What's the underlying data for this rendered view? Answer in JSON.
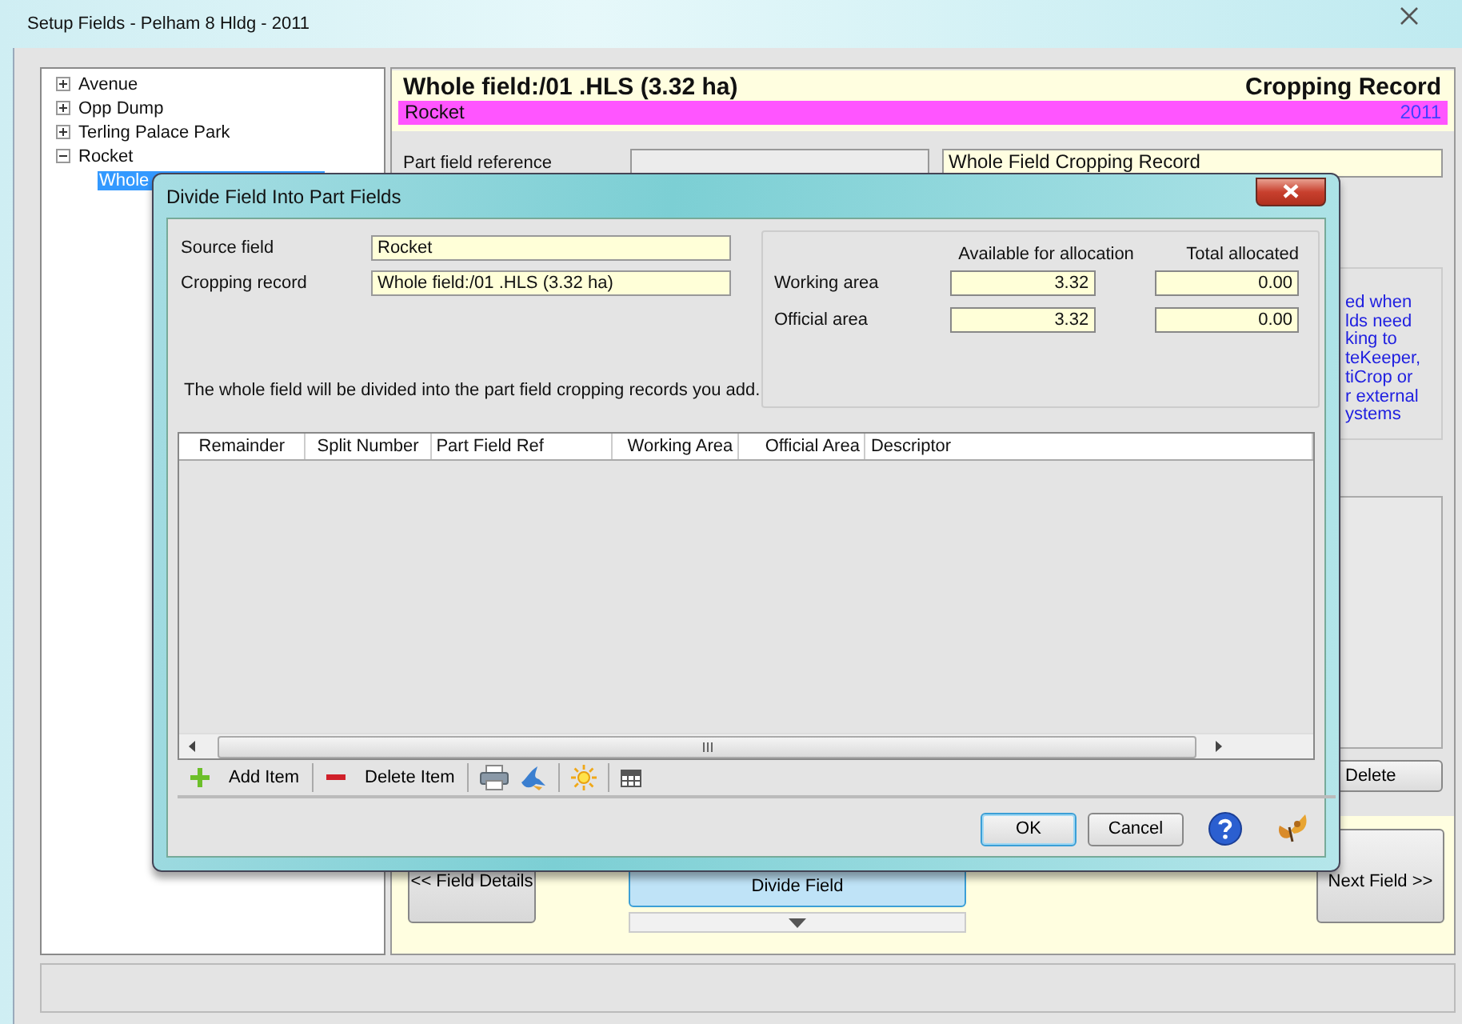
{
  "window": {
    "title": "Setup Fields  - Pelham 8 Hldg - 2011"
  },
  "tree": [
    {
      "label": "Avenue",
      "expanded": false,
      "selected": false
    },
    {
      "label": "Opp Dump",
      "expanded": false,
      "selected": false
    },
    {
      "label": "Terling Palace Park",
      "expanded": false,
      "selected": false
    },
    {
      "label": "Rocket",
      "expanded": true,
      "selected": false,
      "children": [
        {
          "label": "Whole",
          "selected": true
        }
      ]
    }
  ],
  "header": {
    "title": "Whole field:/01 .HLS (3.32 ha)",
    "record_type": "Cropping Record",
    "field_name": "Rocket",
    "year": "2011"
  },
  "form": {
    "part_field_reference_label": "Part field reference",
    "descriptor": "Whole Field Cropping Record"
  },
  "info_note": [
    "ed when",
    "lds need",
    "king to",
    "teKeeper,",
    "tiCrop or",
    "r external",
    "ystems"
  ],
  "delete_button": "Delete",
  "nav": {
    "previous": "<< Field Details",
    "divide": "Divide Field",
    "next": "Next Field >>"
  },
  "dialog": {
    "title": "Divide Field Into Part Fields",
    "source_field_label": "Source field",
    "source_field": "Rocket",
    "cropping_record_label": "Cropping record",
    "cropping_record": "Whole field:/01 .HLS (3.32 ha)",
    "allocation": {
      "columns": [
        "Available for allocation",
        "Total allocated"
      ],
      "rows": [
        {
          "label": "Working area",
          "available": "3.32",
          "allocated": "0.00"
        },
        {
          "label": "Official area",
          "available": "3.32",
          "allocated": "0.00"
        }
      ]
    },
    "message": "The whole field will be divided into the part field cropping records you add.",
    "table": {
      "columns": [
        "Remainder",
        "Split Number",
        "Part Field Ref",
        "Working Area",
        "Official Area",
        "Descriptor"
      ]
    },
    "toolbar": [
      {
        "kind": "add",
        "label": "Add Item"
      },
      {
        "kind": "delete",
        "label": "Delete Item"
      },
      {
        "kind": "print"
      },
      {
        "kind": "bird"
      },
      {
        "kind": "sun"
      },
      {
        "kind": "grid"
      }
    ],
    "buttons": [
      {
        "label": "OK",
        "default": true
      },
      {
        "label": "Cancel",
        "default": false
      }
    ]
  }
}
